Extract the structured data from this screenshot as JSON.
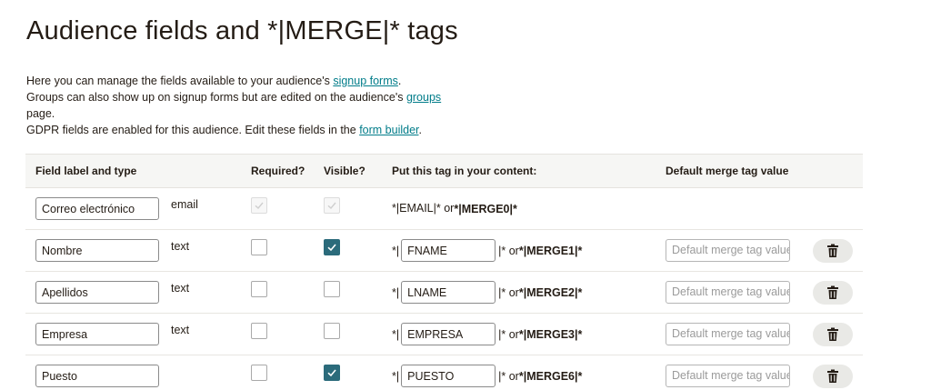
{
  "title": "Audience fields and *|MERGE|* tags",
  "intro": {
    "line1_prefix": "Here you can manage the fields available to your audience's ",
    "line1_link": "signup forms",
    "line1_suffix": ".",
    "line2_prefix": "Groups can also show up on signup forms but are edited on the audience's ",
    "line2_link": "groups",
    "line2_suffix": "page.",
    "line3_prefix": "GDPR fields are enabled for this audience. Edit these fields in the ",
    "line3_link": "form builder",
    "line3_suffix": "."
  },
  "table": {
    "headers": {
      "field": "Field label and type",
      "required": "Required?",
      "visible": "Visible?",
      "tag": "Put this tag in your content:",
      "default": "Default merge tag value"
    },
    "default_placeholder": "Default merge tag value",
    "rows": [
      {
        "label": "Correo electrónico",
        "type": "email",
        "required": true,
        "visible": true,
        "locked": true,
        "tag": "EMAIL",
        "tag_prefix": "*|EMAIL|* or ",
        "merge": "*|MERGE0|*"
      },
      {
        "label": "Nombre",
        "type": "text",
        "required": false,
        "visible": true,
        "tag": "FNAME",
        "tag_open": "*|",
        "tag_close": "|* or ",
        "merge": "*|MERGE1|*"
      },
      {
        "label": "Apellidos",
        "type": "text",
        "required": false,
        "visible": false,
        "tag": "LNAME",
        "tag_open": "*|",
        "tag_close": "|* or ",
        "merge": "*|MERGE2|*"
      },
      {
        "label": "Empresa",
        "type": "text",
        "required": false,
        "visible": false,
        "tag": "EMPRESA",
        "tag_open": "*|",
        "tag_close": "|* or ",
        "merge": "*|MERGE3|*"
      },
      {
        "label": "Puesto",
        "type": "",
        "required": false,
        "visible": true,
        "tag": "PUESTO",
        "tag_open": "*|",
        "tag_close": "|* or ",
        "merge": "*|MERGE6|*"
      }
    ]
  },
  "icons": {
    "trash": "trash-icon",
    "check": "check-icon"
  },
  "colors": {
    "link": "#007c89",
    "checked": "#2b6b7b",
    "header_bg": "#f6f6f4"
  }
}
